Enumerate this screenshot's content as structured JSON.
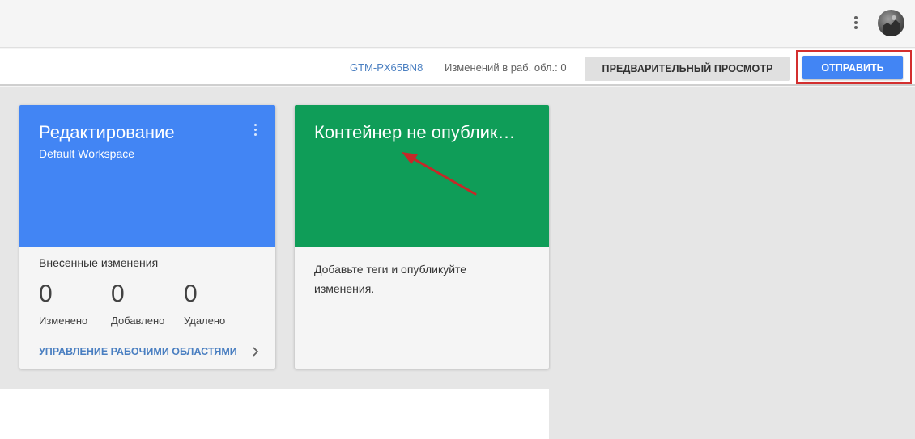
{
  "topbar": {
    "menu_icon": "more-vert-icon",
    "avatar_icon": "user-avatar"
  },
  "subbar": {
    "container_id": "GTM-PX65BN8",
    "changes_text": "Изменений в раб. обл.: 0",
    "preview_label": "ПРЕДВАРИТЕЛЬНЫЙ ПРОСМОТР",
    "submit_label": "ОТПРАВИТЬ"
  },
  "workspace_card": {
    "title": "Редактирование",
    "subtitle": "Default Workspace",
    "section_label": "Внесенные изменения",
    "stats": [
      {
        "value": "0",
        "label": "Изменено"
      },
      {
        "value": "0",
        "label": "Добавлено"
      },
      {
        "value": "0",
        "label": "Удалено"
      }
    ],
    "manage_link": "УПРАВЛЕНИЕ РАБОЧИМИ ОБЛАСТЯМИ"
  },
  "container_card": {
    "title": "Контейнер не опублик…",
    "description": "Добавьте теги и опубликуйте изменения."
  },
  "colors": {
    "workspace_header": "#4285f4",
    "container_header": "#0f9d58",
    "submit_button": "#4285f4",
    "highlight_border": "#d32f2f",
    "arrow": "#c62828"
  }
}
